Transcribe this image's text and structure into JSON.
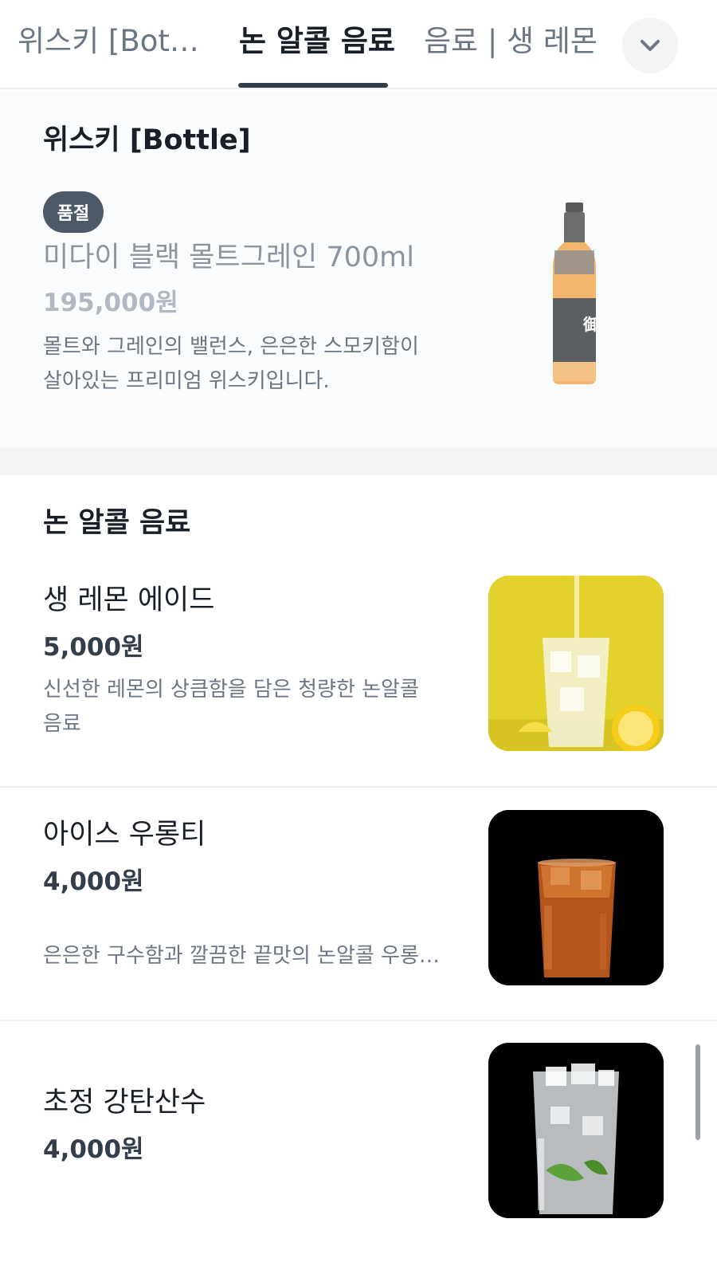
{
  "tabs": {
    "items": [
      {
        "label": "위스키 [Bottle]"
      },
      {
        "label": "논 알콜 음료"
      },
      {
        "label": "음료 | 생 레몬"
      }
    ],
    "active_index": 1,
    "more_icon": "chevron-down-icon"
  },
  "whisky": {
    "title": "위스키 [Bottle]",
    "item": {
      "badge": "품절",
      "name": "미다이 블랙 몰트그레인 700ml",
      "price": "195,000원",
      "description": "몰트와 그레인의 밸런스, 은은한 스모키함이 살아있는 프리미엄 위스키입니다.",
      "sold_out": true
    }
  },
  "non_alcohol": {
    "title": "논 알콜 음료",
    "items": [
      {
        "name": "생 레몬 에이드",
        "price": "5,000원",
        "description": "신선한 레몬의 상큼함을 담은 청량한 논알콜 음료"
      },
      {
        "name": "아이스 우롱티",
        "price": "4,000원",
        "description": "은은한 구수함과 깔끔한 끝맛의 논알콜 우롱티..."
      },
      {
        "name": "초정 강탄산수",
        "price": "4,000원",
        "description": ""
      }
    ]
  },
  "colors": {
    "accent": "#333d4b",
    "section_gap": "#f2f4f6",
    "badge_bg": "#4e5968",
    "muted_text": "#8b95a1"
  }
}
